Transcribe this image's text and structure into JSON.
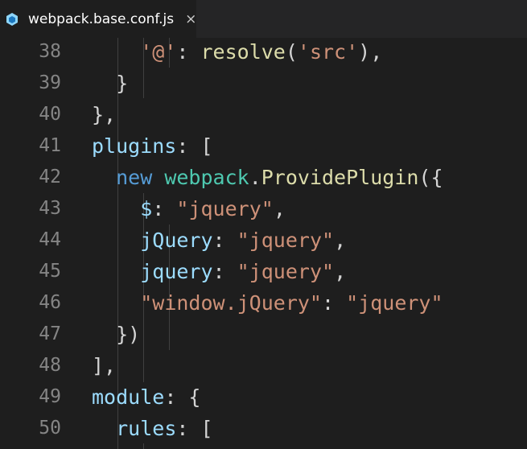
{
  "tab": {
    "title": "webpack.base.conf.js",
    "close": "×",
    "icon": "webpack-cube-icon"
  },
  "colors": {
    "background": "#1e1e1e",
    "line_number": "#858585",
    "property": "#9cdcfe",
    "string": "#ce9178",
    "function": "#dcdcaa",
    "class": "#4ec9b0",
    "keyword": "#569cd6"
  },
  "lines": [
    {
      "num": "38",
      "tokens": [
        {
          "t": "    ",
          "c": "pun"
        },
        {
          "t": "'@'",
          "c": "str"
        },
        {
          "t": ": ",
          "c": "pun"
        },
        {
          "t": "resolve",
          "c": "fn"
        },
        {
          "t": "(",
          "c": "pun"
        },
        {
          "t": "'src'",
          "c": "str"
        },
        {
          "t": "),",
          "c": "pun"
        }
      ]
    },
    {
      "num": "39",
      "tokens": [
        {
          "t": "  }",
          "c": "pun"
        }
      ]
    },
    {
      "num": "40",
      "tokens": [
        {
          "t": "},",
          "c": "pun"
        }
      ]
    },
    {
      "num": "41",
      "tokens": [
        {
          "t": "plugins",
          "c": "key"
        },
        {
          "t": ": [",
          "c": "pun"
        }
      ]
    },
    {
      "num": "42",
      "tokens": [
        {
          "t": "  ",
          "c": "pun"
        },
        {
          "t": "new",
          "c": "kw"
        },
        {
          "t": " ",
          "c": "pun"
        },
        {
          "t": "webpack",
          "c": "cls"
        },
        {
          "t": ".",
          "c": "pun"
        },
        {
          "t": "ProvidePlugin",
          "c": "fn"
        },
        {
          "t": "({",
          "c": "pun"
        }
      ]
    },
    {
      "num": "43",
      "tokens": [
        {
          "t": "    ",
          "c": "pun"
        },
        {
          "t": "$",
          "c": "key"
        },
        {
          "t": ": ",
          "c": "pun"
        },
        {
          "t": "\"jquery\"",
          "c": "str"
        },
        {
          "t": ",",
          "c": "pun"
        }
      ]
    },
    {
      "num": "44",
      "tokens": [
        {
          "t": "    ",
          "c": "pun"
        },
        {
          "t": "jQuery",
          "c": "key"
        },
        {
          "t": ": ",
          "c": "pun"
        },
        {
          "t": "\"jquery\"",
          "c": "str"
        },
        {
          "t": ",",
          "c": "pun"
        }
      ]
    },
    {
      "num": "45",
      "tokens": [
        {
          "t": "    ",
          "c": "pun"
        },
        {
          "t": "jquery",
          "c": "key"
        },
        {
          "t": ": ",
          "c": "pun"
        },
        {
          "t": "\"jquery\"",
          "c": "str"
        },
        {
          "t": ",",
          "c": "pun"
        }
      ]
    },
    {
      "num": "46",
      "tokens": [
        {
          "t": "    ",
          "c": "pun"
        },
        {
          "t": "\"window.jQuery\"",
          "c": "str"
        },
        {
          "t": ": ",
          "c": "pun"
        },
        {
          "t": "\"jquery\"",
          "c": "str"
        }
      ]
    },
    {
      "num": "47",
      "tokens": [
        {
          "t": "  })",
          "c": "pun"
        }
      ]
    },
    {
      "num": "48",
      "tokens": [
        {
          "t": "],",
          "c": "pun"
        }
      ]
    },
    {
      "num": "49",
      "tokens": [
        {
          "t": "module",
          "c": "key"
        },
        {
          "t": ": {",
          "c": "pun"
        }
      ]
    },
    {
      "num": "50",
      "tokens": [
        {
          "t": "  ",
          "c": "pun"
        },
        {
          "t": "rules",
          "c": "key"
        },
        {
          "t": ": [",
          "c": "pun"
        }
      ]
    }
  ]
}
